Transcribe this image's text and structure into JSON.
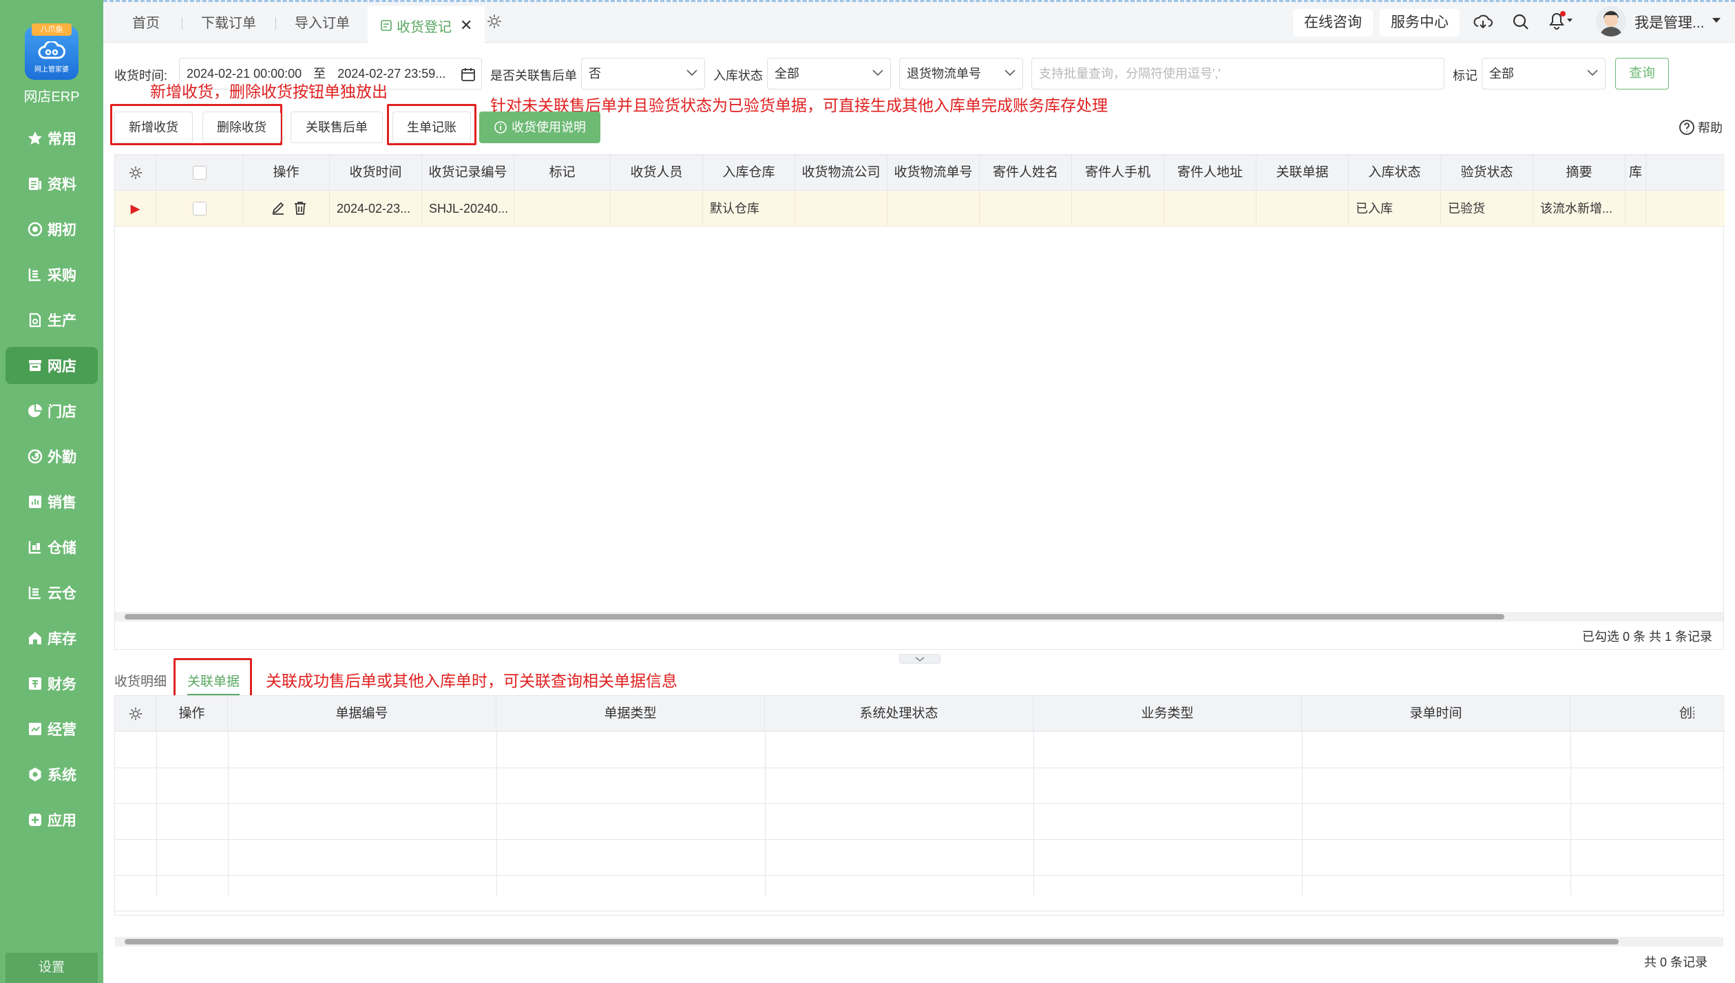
{
  "app": {
    "logo_tag": "八爪鱼",
    "logo_sub": "网上管家婆",
    "name": "网店ERP"
  },
  "sidebar": {
    "items": [
      {
        "label": "常用",
        "icon": "star-icon"
      },
      {
        "label": "资料",
        "icon": "profile-icon"
      },
      {
        "label": "期初",
        "icon": "target-icon"
      },
      {
        "label": "采购",
        "icon": "purchase-icon"
      },
      {
        "label": "生产",
        "icon": "production-icon"
      },
      {
        "label": "网店",
        "icon": "store-icon"
      },
      {
        "label": "门店",
        "icon": "pie-icon"
      },
      {
        "label": "外勤",
        "icon": "field-icon"
      },
      {
        "label": "销售",
        "icon": "sales-icon"
      },
      {
        "label": "仓储",
        "icon": "warehouse-icon"
      },
      {
        "label": "云仓",
        "icon": "cloud-warehouse-icon"
      },
      {
        "label": "库存",
        "icon": "home-icon"
      },
      {
        "label": "财务",
        "icon": "finance-icon"
      },
      {
        "label": "经营",
        "icon": "business-icon"
      },
      {
        "label": "系统",
        "icon": "system-icon"
      },
      {
        "label": "应用",
        "icon": "plus-icon"
      }
    ],
    "active_index": 5,
    "settings": "设置"
  },
  "tabs": {
    "items": [
      "首页",
      "下载订单",
      "导入订单"
    ],
    "active": "收货登记"
  },
  "topright": {
    "consult": "在线咨询",
    "service": "服务中心",
    "user": "我是管理..."
  },
  "filters": {
    "time_label": "收货时间:",
    "time_start": "2024-02-21 00:00:00",
    "time_to": "至",
    "time_end": "2024-02-27 23:59...",
    "linked_label": "是否关联售后单",
    "linked_value": "否",
    "instock_label": "入库状态",
    "instock_value": "全部",
    "logistics_value": "退货物流单号",
    "search_placeholder": "支持批量查询，分隔符使用逗号','",
    "mark_label": "标记",
    "mark_value": "全部",
    "query": "查询"
  },
  "toolbar": {
    "add": "新增收货",
    "delete": "删除收货",
    "link_aftersale": "关联售后单",
    "gen_bill": "生单记账",
    "guide": "收货使用说明",
    "help": "帮助"
  },
  "annotations": {
    "note1": "新增收货，删除收货按钮单独放出",
    "note2": "针对未关联售后单并且验货状态为已验货单据，可直接生成其他入库单完成账务库存处理",
    "note3": "关联成功售后单或其他入库单时，可关联查询相关单据信息"
  },
  "grid": {
    "headers": [
      "操作",
      "收货时间",
      "收货记录编号",
      "标记",
      "收货人员",
      "入库仓库",
      "收货物流公司",
      "收货物流单号",
      "寄件人姓名",
      "寄件人手机",
      "寄件人地址",
      "关联单据",
      "入库状态",
      "验货状态",
      "摘要",
      "库"
    ],
    "rows": [
      [
        "",
        "2024-02-23...",
        "SHJL-20240...",
        "",
        "",
        "默认仓库",
        "",
        "",
        "",
        "",
        "",
        "",
        "已入库",
        "已验货",
        "该流水新增...",
        ""
      ]
    ],
    "footer": "已勾选 0 条  共 1 条记录"
  },
  "bottom": {
    "tabs": [
      "收货明细",
      "关联单据"
    ],
    "active_tab": 1,
    "headers": [
      "操作",
      "单据编号",
      "单据类型",
      "系统处理状态",
      "业务类型",
      "录单时间",
      "创建方式"
    ],
    "footer": "共 0 条记录"
  },
  "colors": {
    "sidebar": "#6dba74",
    "accent": "#5aa762",
    "annotation": "#e02020",
    "selected_row": "#fdf7e6"
  }
}
